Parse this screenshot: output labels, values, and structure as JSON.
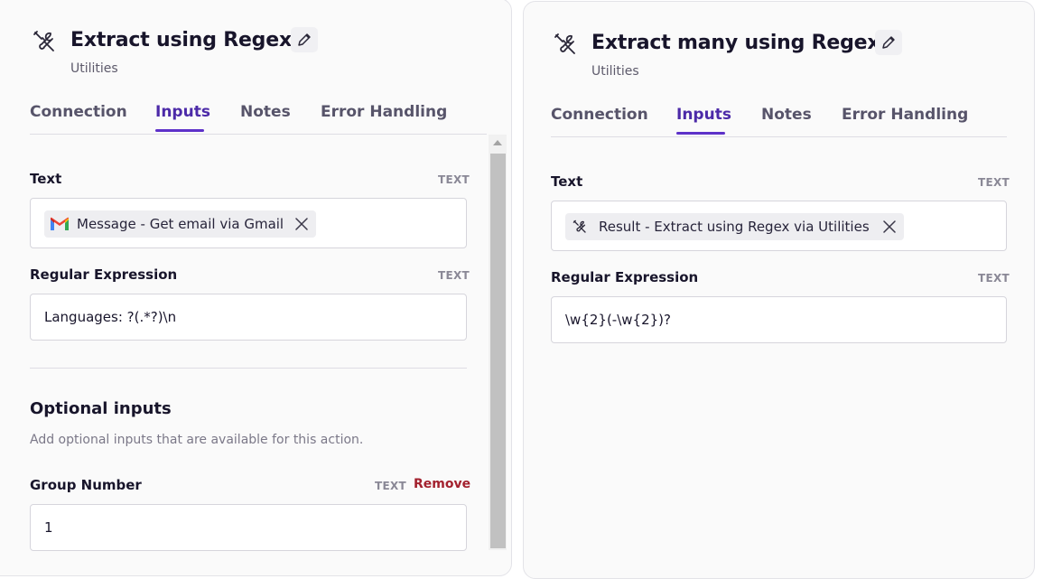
{
  "left": {
    "title": "Extract using Regex",
    "subtitle": "Utilities",
    "tabs": [
      "Connection",
      "Inputs",
      "Notes",
      "Error Handling"
    ],
    "active_tab": "Inputs",
    "fields": {
      "text": {
        "label": "Text",
        "type": "TEXT",
        "chip": "Message - Get email via Gmail",
        "chip_icon": "gmail-icon"
      },
      "regex": {
        "label": "Regular Expression",
        "type": "TEXT",
        "value": "Languages:  ?(.*?)\\n"
      }
    },
    "optional": {
      "title": "Optional inputs",
      "description": "Add optional inputs that are available for this action."
    },
    "group_number": {
      "label": "Group Number",
      "type": "TEXT",
      "remove_label": "Remove",
      "value": "1"
    }
  },
  "right": {
    "title": "Extract many using Regex",
    "subtitle": "Utilities",
    "tabs": [
      "Connection",
      "Inputs",
      "Notes",
      "Error Handling"
    ],
    "active_tab": "Inputs",
    "fields": {
      "text": {
        "label": "Text",
        "type": "TEXT",
        "chip": "Result - Extract using Regex via Utilities",
        "chip_icon": "tools-icon"
      },
      "regex": {
        "label": "Regular Expression",
        "type": "TEXT",
        "value": "\\w{2}(-\\w{2})?"
      }
    }
  },
  "colors": {
    "accent": "#5d31c9",
    "remove": "#a3212e",
    "panel_bg": "#fafafa"
  }
}
